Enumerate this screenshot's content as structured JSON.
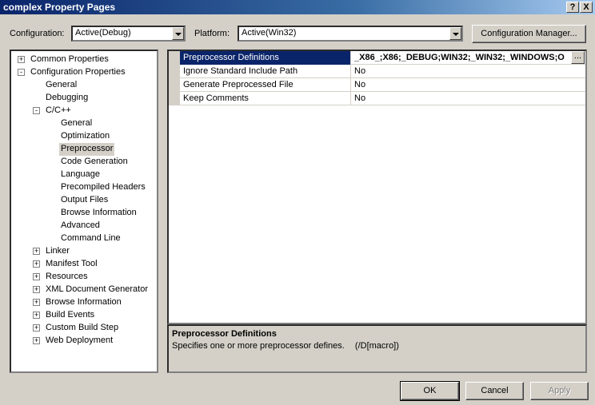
{
  "window": {
    "title": "complex Property Pages",
    "help_glyph": "?",
    "close_glyph": "X"
  },
  "configuration": {
    "label": "Configuration:",
    "value": "Active(Debug)"
  },
  "platform": {
    "label": "Platform:",
    "value": "Active(Win32)"
  },
  "config_manager_label": "Configuration Manager...",
  "tree": {
    "common_properties": "Common Properties",
    "configuration_properties": "Configuration Properties",
    "general": "General",
    "debugging": "Debugging",
    "cpp": "C/C++",
    "cpp_children": [
      "General",
      "Optimization",
      "Preprocessor",
      "Code Generation",
      "Language",
      "Precompiled Headers",
      "Output Files",
      "Browse Information",
      "Advanced",
      "Command Line"
    ],
    "after": [
      "Linker",
      "Manifest Tool",
      "Resources",
      "XML Document Generator",
      "Browse Information",
      "Build Events",
      "Custom Build Step",
      "Web Deployment"
    ],
    "plus_glyph": "+",
    "minus_glyph": "-"
  },
  "properties": [
    {
      "name": "Preprocessor Definitions",
      "value": "_X86_;X86;_DEBUG;WIN32;_WIN32;_WINDOWS;O"
    },
    {
      "name": "Ignore Standard Include Path",
      "value": "No"
    },
    {
      "name": "Generate Preprocessed File",
      "value": "No"
    },
    {
      "name": "Keep Comments",
      "value": "No"
    }
  ],
  "ellipsis_label": "...",
  "description": {
    "title": "Preprocessor Definitions",
    "text": "Specifies one or more preprocessor defines.",
    "switch": "(/D[macro])"
  },
  "buttons": {
    "ok": "OK",
    "cancel": "Cancel",
    "apply": "Apply"
  }
}
